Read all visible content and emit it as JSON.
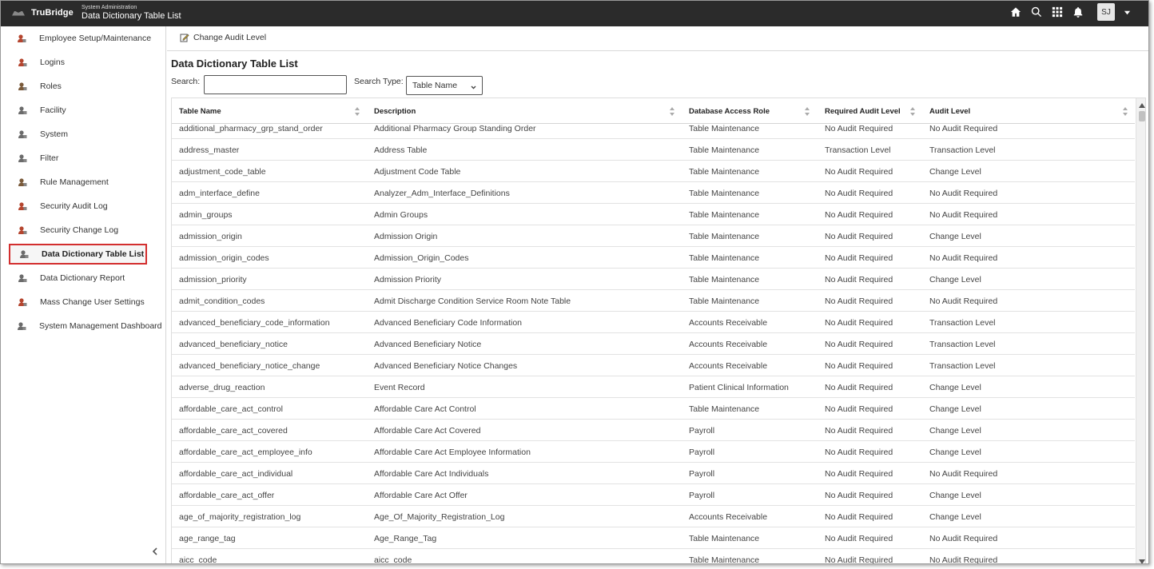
{
  "app": {
    "brand": "TruBridge",
    "section": "System Administration",
    "page_title": "Data Dictionary Table List",
    "user_initials": "SJ",
    "icons": [
      "home-icon",
      "search-icon",
      "apps-grid-icon",
      "bell-icon",
      "chevron-down-icon"
    ]
  },
  "sidebar": {
    "items": [
      {
        "label": "Employee Setup/Maintenance",
        "icon": "user-gear-icon",
        "active": false
      },
      {
        "label": "Logins",
        "icon": "user-key-icon",
        "active": false
      },
      {
        "label": "Roles",
        "icon": "roles-icon",
        "active": false
      },
      {
        "label": "Facility",
        "icon": "facility-icon",
        "active": false
      },
      {
        "label": "System",
        "icon": "system-icon",
        "active": false
      },
      {
        "label": "Filter",
        "icon": "filter-icon",
        "active": false
      },
      {
        "label": "Rule Management",
        "icon": "rules-icon",
        "active": false
      },
      {
        "label": "Security Audit Log",
        "icon": "audit-log-icon",
        "active": false
      },
      {
        "label": "Security Change Log",
        "icon": "change-log-icon",
        "active": false
      },
      {
        "label": "Data Dictionary Table List",
        "icon": "table-list-icon",
        "active": true
      },
      {
        "label": "Data Dictionary Report",
        "icon": "report-icon",
        "active": false
      },
      {
        "label": "Mass Change User Settings",
        "icon": "mass-change-icon",
        "active": false
      },
      {
        "label": "System Management Dashboard",
        "icon": "dashboard-icon",
        "active": false
      }
    ],
    "collapse_icon": "chevron-left-icon"
  },
  "toolbar": {
    "change_audit_label": "Change Audit Level"
  },
  "main": {
    "title": "Data Dictionary Table List",
    "search_label": "Search:",
    "search_value": "",
    "search_type_label": "Search Type:",
    "search_type_value": "Table Name"
  },
  "table": {
    "columns": [
      "Table Name",
      "Description",
      "Database Access Role",
      "Required Audit Level",
      "Audit Level"
    ],
    "rows": [
      [
        "additional_pharmacy_grp_stand_order",
        "Additional Pharmacy Group Standing Order",
        "Table Maintenance",
        "No Audit Required",
        "No Audit Required"
      ],
      [
        "address_master",
        "Address Table",
        "Table Maintenance",
        "Transaction Level",
        "Transaction Level"
      ],
      [
        "adjustment_code_table",
        "Adjustment Code Table",
        "Table Maintenance",
        "No Audit Required",
        "Change Level"
      ],
      [
        "adm_interface_define",
        "Analyzer_Adm_Interface_Definitions",
        "Table Maintenance",
        "No Audit Required",
        "No Audit Required"
      ],
      [
        "admin_groups",
        "Admin Groups",
        "Table Maintenance",
        "No Audit Required",
        "No Audit Required"
      ],
      [
        "admission_origin",
        "Admission Origin",
        "Table Maintenance",
        "No Audit Required",
        "Change Level"
      ],
      [
        "admission_origin_codes",
        "Admission_Origin_Codes",
        "Table Maintenance",
        "No Audit Required",
        "No Audit Required"
      ],
      [
        "admission_priority",
        "Admission Priority",
        "Table Maintenance",
        "No Audit Required",
        "Change Level"
      ],
      [
        "admit_condition_codes",
        "Admit Discharge Condition Service Room Note Table",
        "Table Maintenance",
        "No Audit Required",
        "No Audit Required"
      ],
      [
        "advanced_beneficiary_code_information",
        "Advanced Beneficiary Code Information",
        "Accounts Receivable",
        "No Audit Required",
        "Transaction Level"
      ],
      [
        "advanced_beneficiary_notice",
        "Advanced Beneficiary Notice",
        "Accounts Receivable",
        "No Audit Required",
        "Transaction Level"
      ],
      [
        "advanced_beneficiary_notice_change",
        "Advanced Beneficiary Notice Changes",
        "Accounts Receivable",
        "No Audit Required",
        "Transaction Level"
      ],
      [
        "adverse_drug_reaction",
        "Event Record",
        "Patient Clinical Information",
        "No Audit Required",
        "Change Level"
      ],
      [
        "affordable_care_act_control",
        "Affordable Care Act Control",
        "Table Maintenance",
        "No Audit Required",
        "Change Level"
      ],
      [
        "affordable_care_act_covered",
        "Affordable Care Act Covered",
        "Payroll",
        "No Audit Required",
        "Change Level"
      ],
      [
        "affordable_care_act_employee_info",
        "Affordable Care Act Employee Information",
        "Payroll",
        "No Audit Required",
        "Change Level"
      ],
      [
        "affordable_care_act_individual",
        "Affordable Care Act Individuals",
        "Payroll",
        "No Audit Required",
        "No Audit Required"
      ],
      [
        "affordable_care_act_offer",
        "Affordable Care Act Offer",
        "Payroll",
        "No Audit Required",
        "Change Level"
      ],
      [
        "age_of_majority_registration_log",
        "Age_Of_Majority_Registration_Log",
        "Accounts Receivable",
        "No Audit Required",
        "Change Level"
      ],
      [
        "age_range_tag",
        "Age_Range_Tag",
        "Table Maintenance",
        "No Audit Required",
        "No Audit Required"
      ],
      [
        "aicc_code",
        "aicc_code",
        "Table Maintenance",
        "No Audit Required",
        "No Audit Required"
      ]
    ]
  },
  "colors": {
    "topbar": "#2b2b2b",
    "active_outline": "#d32f2f"
  }
}
